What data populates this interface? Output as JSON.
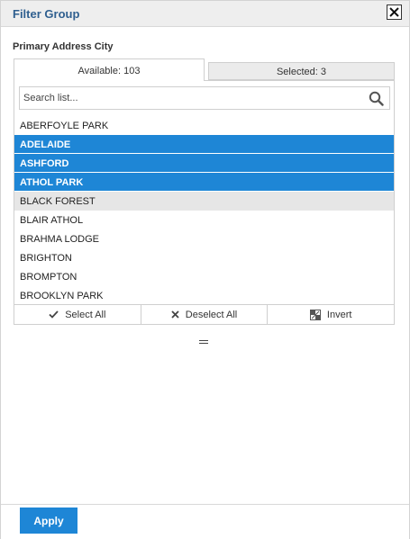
{
  "dialog": {
    "title": "Filter Group"
  },
  "field_label": "Primary Address City",
  "tabs": {
    "available": "Available: 103",
    "selected": "Selected: 3"
  },
  "search": {
    "placeholder": "Search list..."
  },
  "items": [
    {
      "label": "ABERFOYLE PARK",
      "state": "normal"
    },
    {
      "label": "ADELAIDE",
      "state": "selected"
    },
    {
      "label": "ASHFORD",
      "state": "selected"
    },
    {
      "label": "ATHOL PARK",
      "state": "selected"
    },
    {
      "label": "BLACK FOREST",
      "state": "hover"
    },
    {
      "label": "BLAIR ATHOL",
      "state": "normal"
    },
    {
      "label": "BRAHMA LODGE",
      "state": "normal"
    },
    {
      "label": "BRIGHTON",
      "state": "normal"
    },
    {
      "label": "BROMPTON",
      "state": "normal"
    },
    {
      "label": "BROOKLYN PARK",
      "state": "normal"
    }
  ],
  "actions": {
    "select_all": "Select All",
    "deselect_all": "Deselect All",
    "invert": "Invert"
  },
  "footer": {
    "apply": "Apply"
  },
  "colors": {
    "accent": "#1e86d6",
    "title": "#2f5f8f",
    "hover": "#e6e6e6"
  }
}
